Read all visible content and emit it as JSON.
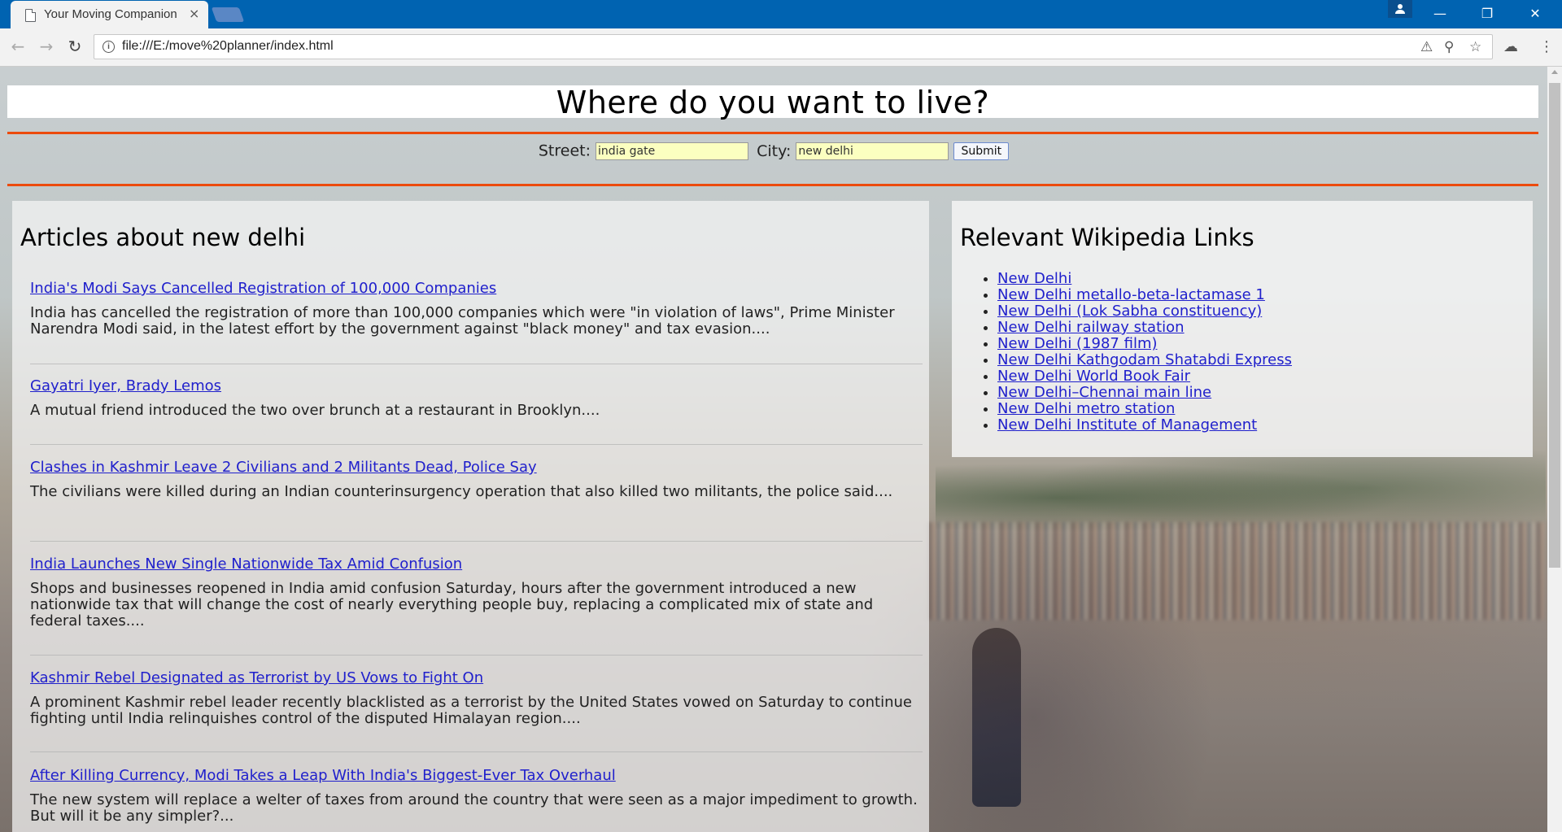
{
  "browser": {
    "tab_title": "Your Moving Companion",
    "tab_close": "×",
    "url": "file:///E:/move%20planner/index.html",
    "window_controls": {
      "minimize": "—",
      "restore": "❐",
      "close": "✕"
    }
  },
  "page": {
    "heading": "Where do you want to live?",
    "form": {
      "street_label": "Street:",
      "street_value": "india gate",
      "city_label": "City:",
      "city_value": "new delhi",
      "submit_label": "Submit"
    },
    "articles": {
      "title": "Articles about new delhi",
      "items": [
        {
          "headline": "India's Modi Says Cancelled Registration of 100,000 Companies",
          "summary": "India has cancelled the registration of more than 100,000 companies which were \"in violation of laws\", Prime Minister Narendra Modi said, in the latest effort by the government against \"black money\" and tax evasion...."
        },
        {
          "headline": "Gayatri Iyer, Brady Lemos",
          "summary": "A mutual friend introduced the two over brunch at a restaurant in Brooklyn...."
        },
        {
          "headline": "Clashes in Kashmir Leave 2 Civilians and 2 Militants Dead, Police Say",
          "summary": "The civilians were killed during an Indian counterinsurgency operation that also killed two militants, the police said...."
        },
        {
          "headline": "India Launches New Single Nationwide Tax Amid Confusion",
          "summary": "Shops and businesses reopened in India amid confusion Saturday, hours after the government introduced a new nationwide tax that will change the cost of nearly everything people buy, replacing a complicated mix of state and federal taxes...."
        },
        {
          "headline": "Kashmir Rebel Designated as Terrorist by US Vows to Fight On",
          "summary": "A prominent Kashmir rebel leader recently blacklisted as a terrorist by the United States vowed on Saturday to continue fighting until India relinquishes control of the disputed Himalayan region...."
        },
        {
          "headline": "After Killing Currency, Modi Takes a Leap With India's Biggest-Ever Tax Overhaul",
          "summary": "The new system will replace a welter of taxes from around the country that were seen as a major impediment to growth. But will it be any simpler?..."
        }
      ]
    },
    "wikipedia": {
      "title": "Relevant Wikipedia Links",
      "links": [
        "New Delhi",
        "New Delhi metallo-beta-lactamase 1",
        "New Delhi (Lok Sabha constituency)",
        "New Delhi railway station",
        "New Delhi (1987 film)",
        "New Delhi Kathgodam Shatabdi Express",
        "New Delhi World Book Fair",
        "New Delhi–Chennai main line",
        "New Delhi metro station",
        "New Delhi Institute of Management"
      ]
    }
  },
  "colors": {
    "titlebar": "#0063b1",
    "rule": "#ec4b0d",
    "link": "#2020cc",
    "input_bg": "#fbffc0"
  }
}
